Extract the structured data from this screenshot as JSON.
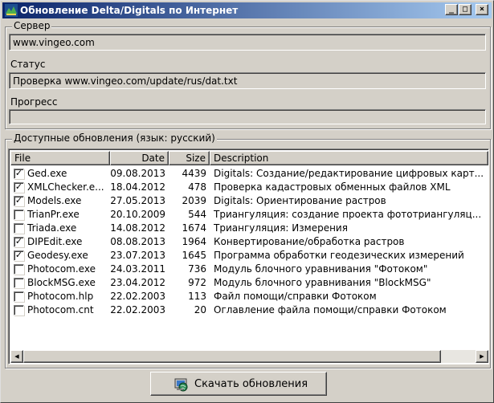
{
  "window": {
    "title": "Обновление Delta/Digitals по Интернет",
    "buttons": {
      "minimize": "_",
      "maximize": "□",
      "close": "×"
    }
  },
  "server_group": {
    "legend": "Сервер",
    "server_value": "www.vingeo.com",
    "status_label": "Статус",
    "status_value": "Проверка www.vingeo.com/update/rus/dat.txt",
    "progress_label": "Прогресс",
    "progress_value": 0
  },
  "updates_group": {
    "legend": "Доступные обновления (язык: русский)",
    "columns": [
      "File",
      "Date",
      "Size",
      "Description"
    ],
    "rows": [
      {
        "checked": true,
        "file": "Ged.exe",
        "date": "09.08.2013",
        "size": "4439",
        "description": "Digitals: Создание/редактирование цифровых карт..."
      },
      {
        "checked": true,
        "file": "XMLChecker.e...",
        "date": "18.04.2012",
        "size": "478",
        "description": "Проверка кадастровых обменных файлов XML"
      },
      {
        "checked": true,
        "file": "Models.exe",
        "date": "27.05.2013",
        "size": "2039",
        "description": "Digitals: Ориентирование растров"
      },
      {
        "checked": false,
        "file": "TrianPr.exe",
        "date": "20.10.2009",
        "size": "544",
        "description": "Триангуляция: создание проекта фототриангуляц..."
      },
      {
        "checked": false,
        "file": "Triada.exe",
        "date": "14.08.2012",
        "size": "1674",
        "description": "Триангуляция: Измерения"
      },
      {
        "checked": true,
        "file": "DIPEdit.exe",
        "date": "08.08.2013",
        "size": "1964",
        "description": "Конвертирование/обработка растров"
      },
      {
        "checked": true,
        "file": "Geodesy.exe",
        "date": "23.07.2013",
        "size": "1645",
        "description": "Программа обработки геодезических измерений"
      },
      {
        "checked": false,
        "file": "Photocom.exe",
        "date": "24.03.2011",
        "size": "736",
        "description": "Модуль блочного уравнивания \"Фотоком\""
      },
      {
        "checked": false,
        "file": "BlockMSG.exe",
        "date": "23.04.2012",
        "size": "972",
        "description": "Модуль блочного уравнивания \"BlockMSG\""
      },
      {
        "checked": false,
        "file": "Photocom.hlp",
        "date": "22.02.2003",
        "size": "113",
        "description": "Файл помощи/справки Фотоком"
      },
      {
        "checked": false,
        "file": "Photocom.cnt",
        "date": "22.02.2003",
        "size": "20",
        "description": "Оглавление файла помощи/справки Фотоком"
      }
    ]
  },
  "download_button": {
    "label": "Скачать обновления",
    "icon": "download-globe-icon"
  }
}
